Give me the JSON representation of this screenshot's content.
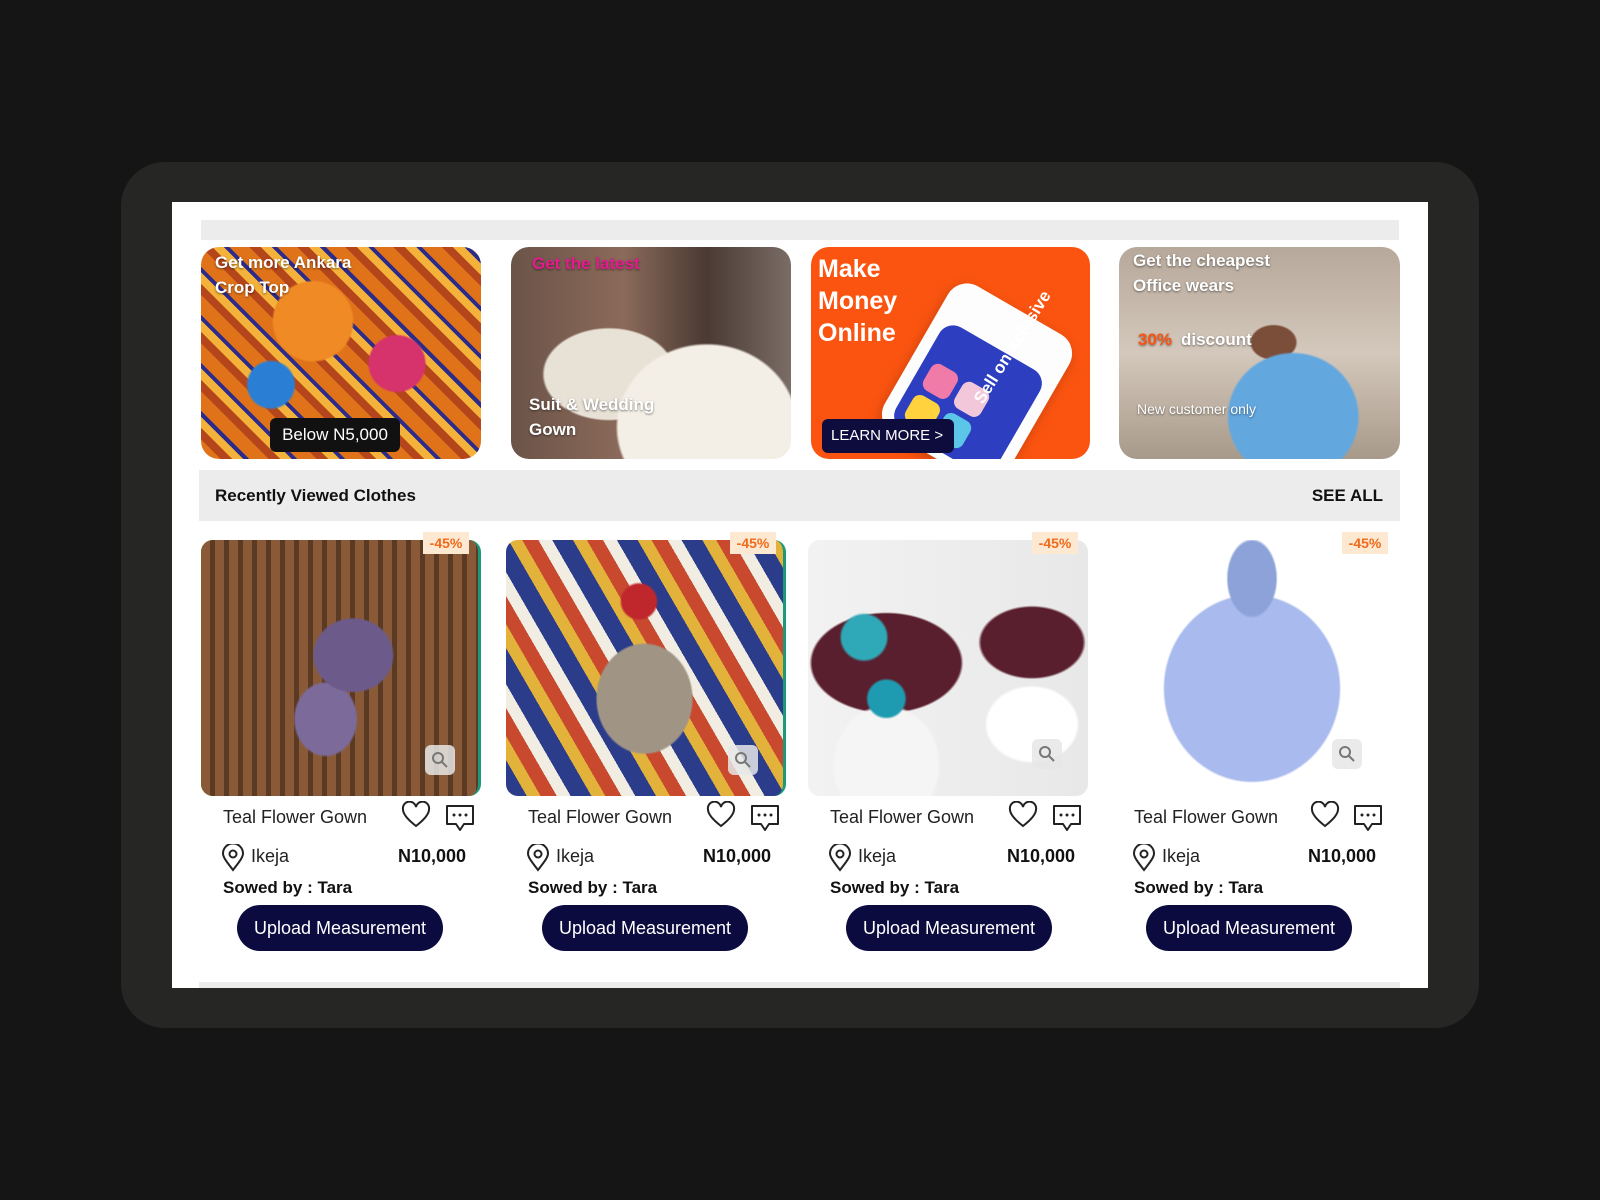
{
  "banners": [
    {
      "title": "Get more Ankara Crop Top",
      "badge": "Below N5,000"
    },
    {
      "title": "Get the latest",
      "subtitle": "Suit & Wedding Gown",
      "title_color": "#e41a8f"
    },
    {
      "title": "Make Money Online",
      "cta": "LEARN MORE  >",
      "tagline": "Sell on Xclusive",
      "brand_color": "#fb5410"
    },
    {
      "title": "Get the cheapest Office wears",
      "discount_number": "30%",
      "discount_word": "discount",
      "note": "New customer only",
      "discount_color": "#fb5410"
    }
  ],
  "section": {
    "title": "Recently Viewed Clothes",
    "see_all": "SEE ALL"
  },
  "products": [
    {
      "discount": "-45%",
      "name": "Teal Flower Gown",
      "location": "Ikeja",
      "price": "N10,000",
      "seller": "Sowed by : Tara",
      "cta": "Upload Measurement"
    },
    {
      "discount": "-45%",
      "name": "Teal Flower Gown",
      "location": "Ikeja",
      "price": "N10,000",
      "seller": "Sowed by : Tara",
      "cta": "Upload Measurement"
    },
    {
      "discount": "-45%",
      "name": "Teal Flower Gown",
      "location": "Ikeja",
      "price": "N10,000",
      "seller": "Sowed by : Tara",
      "cta": "Upload Measurement"
    },
    {
      "discount": "-45%",
      "name": "Teal Flower Gown",
      "location": "Ikeja",
      "price": "N10,000",
      "seller": "Sowed by : Tara",
      "cta": "Upload Measurement"
    }
  ],
  "colors": {
    "button_navy": "#0b0b40",
    "discount_orange": "#f06a1b",
    "section_gray": "#ececec"
  }
}
